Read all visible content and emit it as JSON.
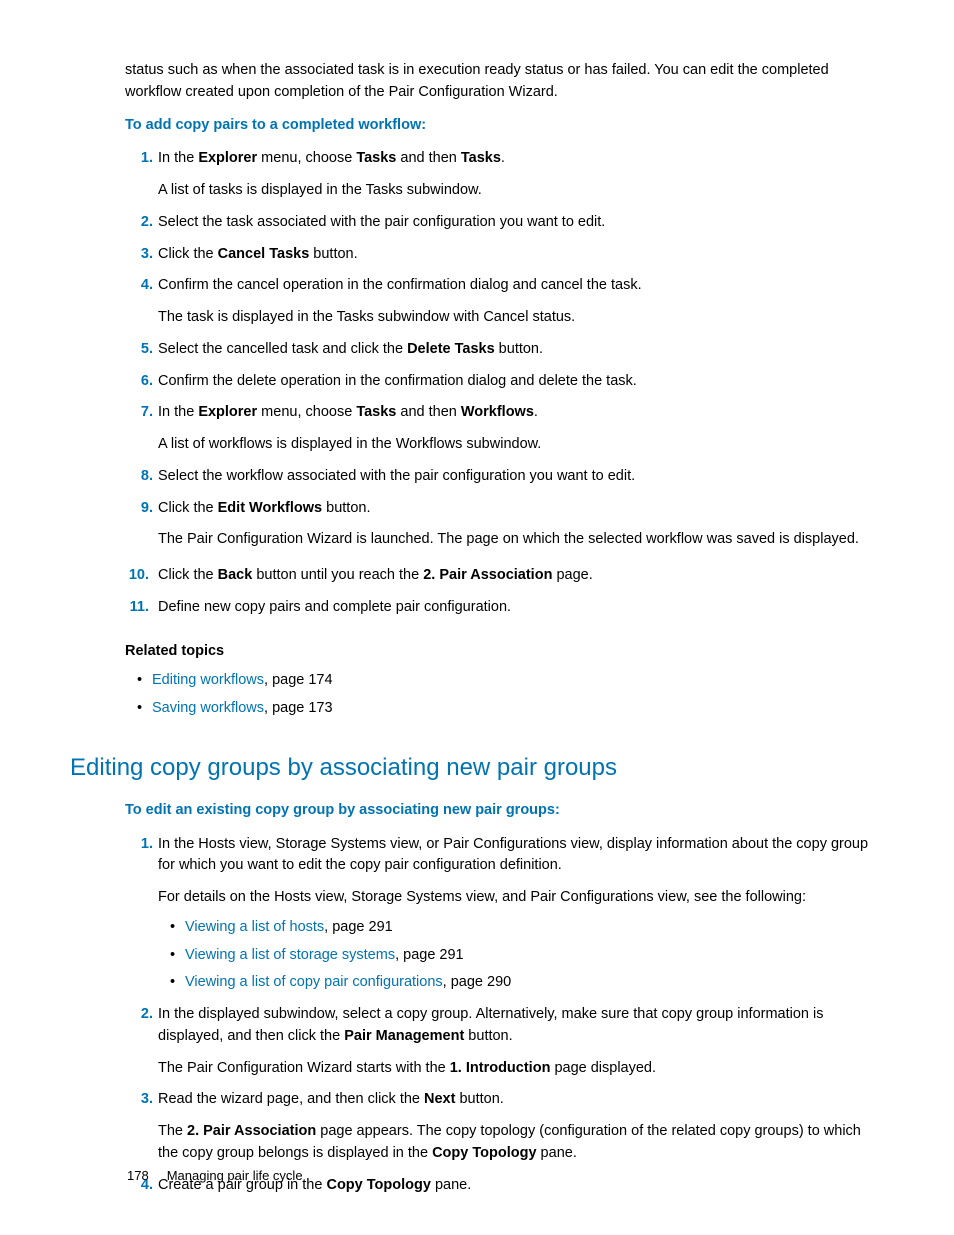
{
  "introParagraph": "status such as when the associated task is in execution ready status or has failed. You can edit the completed workflow created upon completion of the Pair Configuration Wizard.",
  "sub1": "To add copy pairs to a completed workflow:",
  "steps1": {
    "s1a": "In the ",
    "s1b": "Explorer",
    "s1c": " menu, choose ",
    "s1d": "Tasks",
    "s1e": " and then ",
    "s1f": "Tasks",
    "s1g": ".",
    "s1p": "A list of tasks is displayed in the Tasks subwindow.",
    "s2": "Select the task associated with the pair configuration you want to edit.",
    "s3a": "Click the ",
    "s3b": "Cancel Tasks",
    "s3c": " button.",
    "s4": "Confirm the cancel operation in the confirmation dialog and cancel the task.",
    "s4p": "The task is displayed in the Tasks subwindow with Cancel status.",
    "s5a": "Select the cancelled task and click the ",
    "s5b": "Delete Tasks",
    "s5c": " button.",
    "s6": "Confirm the delete operation in the confirmation dialog and delete the task.",
    "s7a": "In the ",
    "s7b": "Explorer",
    "s7c": " menu, choose ",
    "s7d": "Tasks",
    "s7e": " and then ",
    "s7f": "Workflows",
    "s7g": ".",
    "s7p": "A list of workflows is displayed in the Workflows subwindow.",
    "s8": "Select the workflow associated with the pair configuration you want to edit.",
    "s9a": "Click the ",
    "s9b": "Edit Workflows",
    "s9c": " button.",
    "s9p": "The Pair Configuration Wizard is launched. The page on which the selected workflow was saved is displayed.",
    "s10a": "Click the ",
    "s10b": "Back",
    "s10c": " button until you reach the ",
    "s10d": "2. Pair Association",
    "s10e": " page.",
    "s11": "Define new copy pairs and complete pair configuration."
  },
  "relatedHeading": "Related topics",
  "related": {
    "r1link": "Editing workflows",
    "r1rest": ", page 174",
    "r2link": "Saving workflows",
    "r2rest": ", page 173"
  },
  "sectionHeading": "Editing copy groups by associating new pair groups",
  "sub2": "To edit an existing copy group by associating new pair groups:",
  "steps2": {
    "s1": "In the Hosts view, Storage Systems view, or Pair Configurations view, display information about the copy group for which you want to edit the copy pair configuration definition.",
    "s1p": "For details on the Hosts view, Storage Systems view, and Pair Configurations view, see the following:",
    "b1link": "Viewing a list of hosts",
    "b1rest": ", page 291",
    "b2link": "Viewing a list of storage systems",
    "b2rest": ", page 291",
    "b3link": "Viewing a list of copy pair configurations",
    "b3rest": ", page 290",
    "s2a": "In the displayed subwindow, select a copy group. Alternatively, make sure that copy group information is displayed, and then click the ",
    "s2b": "Pair Management",
    "s2c": " button.",
    "s2pa": "The Pair Configuration Wizard starts with the ",
    "s2pb": "1. Introduction",
    "s2pc": " page displayed.",
    "s3a": "Read the wizard page, and then click the ",
    "s3b": "Next",
    "s3c": " button.",
    "s3pa": "The ",
    "s3pb": "2. Pair Association",
    "s3pc": " page appears. The copy topology (configuration of the related copy groups) to which the copy group belongs is displayed in the ",
    "s3pd": "Copy Topology",
    "s3pe": " pane.",
    "s4a": "Create a pair group in the ",
    "s4b": "Copy Topology",
    "s4c": " pane."
  },
  "footer": {
    "page": "178",
    "chapter": "Managing pair life cycle"
  },
  "nums": {
    "n1": "1.",
    "n2": "2.",
    "n3": "3.",
    "n4": "4.",
    "n5": "5.",
    "n6": "6.",
    "n7": "7.",
    "n8": "8.",
    "n9": "9.",
    "n10": "10.",
    "n11": "11."
  }
}
